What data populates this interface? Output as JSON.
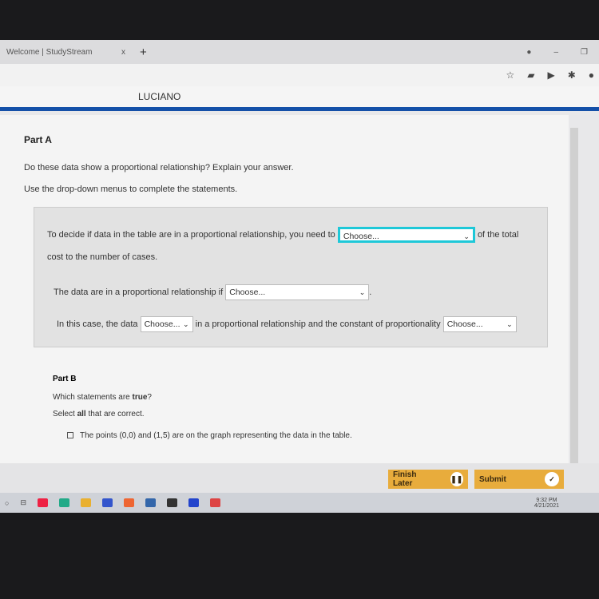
{
  "browser": {
    "tab_title": "Welcome | StudyStream",
    "tab_close": "x",
    "new_tab": "+"
  },
  "header": {
    "user": "LUCIANO"
  },
  "part_a": {
    "title": "Part A",
    "question": "Do these data show a proportional relationship? Explain your answer.",
    "instruction": "Use the drop-down menus to complete the statements.",
    "s1_before": "To decide if data in the table are in a proportional relationship, you need to",
    "s1_after": "of the total cost to the number of cases.",
    "s2_before": "The data are in a proportional relationship if",
    "s2_after": ".",
    "s3_before": "In this case, the data",
    "s3_middle": "in a proportional relationship and the constant of proportionality",
    "dropdown_value": "Choose..."
  },
  "part_b": {
    "title": "Part B",
    "question_before": "Which statements are ",
    "question_bold": "true",
    "question_after": "?",
    "select_before": "Select ",
    "select_bold": "all",
    "select_after": " that are correct.",
    "option1": "The points (0,0) and (1,5) are on the graph representing the data in the table."
  },
  "footer": {
    "finish_later": "Finish Later",
    "submit": "Submit"
  },
  "taskbar": {
    "time": "9:32 PM",
    "date": "4/21/2021"
  },
  "colors": {
    "accent_blue": "#1450a8",
    "button": "#e8ac3c",
    "highlight": "#1ec8d8"
  }
}
